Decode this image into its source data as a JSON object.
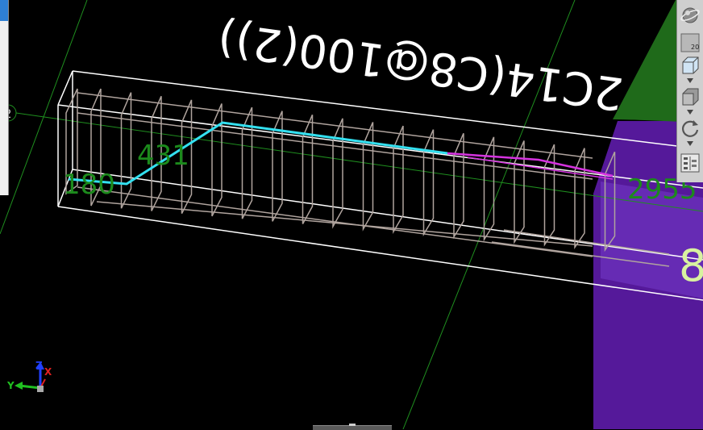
{
  "viewport": {
    "background": "#000000",
    "grid_color": "#1f8f1f",
    "beam_outline_color": "#ffffff",
    "rebar_color": "#b0a49e",
    "highlight_bar_color": "#33e0f0",
    "highlight_bar2_color": "#d633e0",
    "annotation_color": "#1c8a1c",
    "beam_label": "2C14(C8@100(2))",
    "dimensions": {
      "left_segment": "180",
      "slope_segment": "431",
      "right_length": "2955"
    },
    "edge_label": "2",
    "side_digit": "8",
    "regions": {
      "purple_color": "#55199a",
      "green_color": "#1f6a1a"
    }
  },
  "axis_triad": {
    "x_label": "X",
    "y_label": "Y",
    "z_label": "Z",
    "x_color": "#e02020",
    "y_color": "#20c020",
    "z_color": "#2040ff"
  },
  "toolbar": {
    "tools": [
      {
        "icon": "globe-icon"
      },
      {
        "icon": "cube-grid-icon",
        "label": "20"
      },
      {
        "icon": "wire-cube-icon"
      },
      {
        "icon": "solid-cube-icon"
      },
      {
        "icon": "rotate-icon"
      },
      {
        "icon": "layers-icon"
      }
    ]
  },
  "left_panel": {
    "accent_color": "#2e7fd4"
  }
}
